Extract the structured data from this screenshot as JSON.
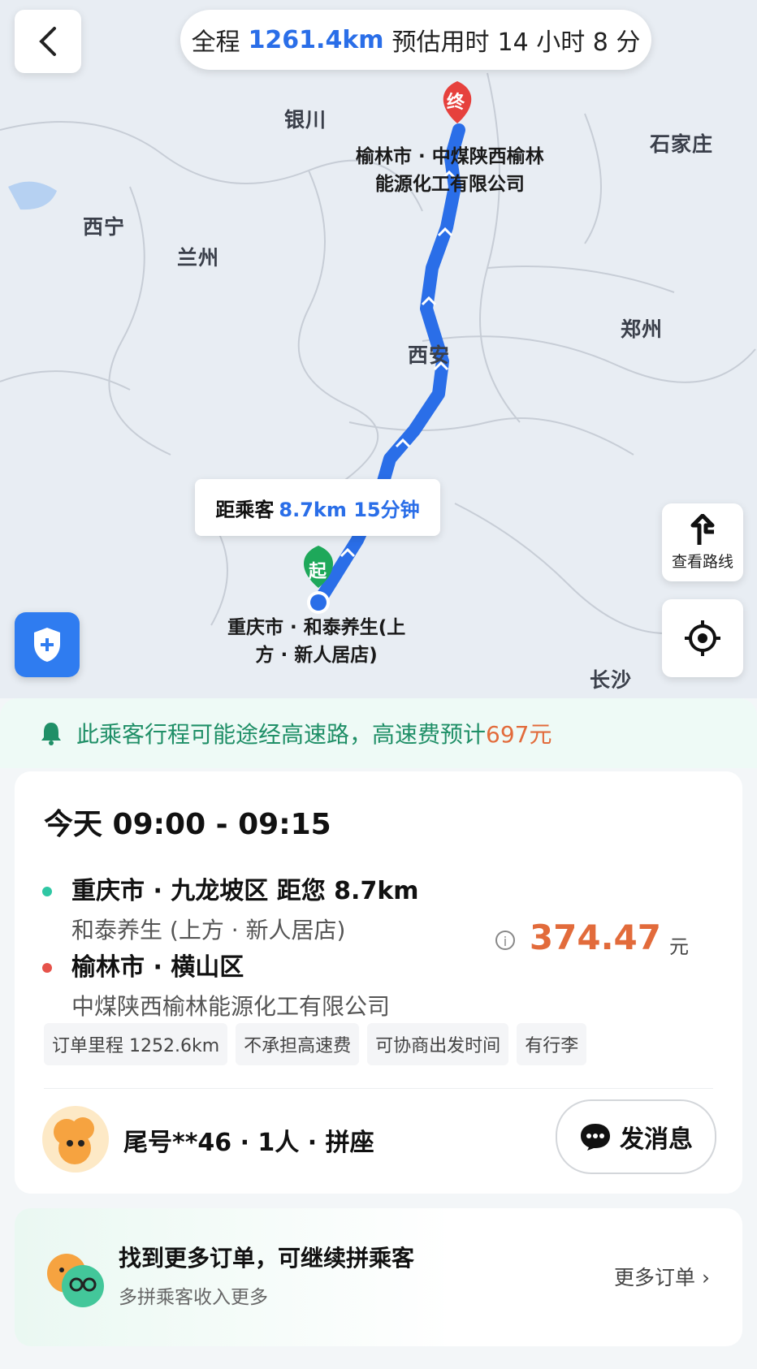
{
  "header": {
    "summary_prefix": "全程",
    "total_distance": "1261.4km",
    "estimate_label": "预估用时",
    "estimate_time": "14 小时 8 分"
  },
  "map": {
    "cities": [
      "银川",
      "石家庄",
      "西宁",
      "兰州",
      "郑州",
      "西安",
      "长沙"
    ],
    "end_marker": "终",
    "end_label_line1": "榆林市 · 中煤陕西榆林",
    "end_label_line2": "能源化工有限公司",
    "start_marker": "起",
    "start_label_line1": "重庆市 · 和泰养生(上",
    "start_label_line2": "方 · 新人居店)",
    "eta_prefix": "距乘客",
    "eta_value": "8.7km 15分钟",
    "route_button_label": "查看路线",
    "route_color": "#2a6ee8"
  },
  "notice": {
    "text": "此乘客行程可能途经高速路，高速费预计",
    "fee": "697元"
  },
  "order": {
    "time_range": "今天 09:00 - 09:15",
    "pickup_main": "重庆市 · 九龙坡区  距您 8.7km",
    "pickup_sub": "和泰养生 (上方 · 新人居店)",
    "dropoff_main": "榆林市 · 横山区",
    "dropoff_sub": "中煤陕西榆林能源化工有限公司",
    "price": "374.47",
    "price_unit": "元",
    "tags": [
      "订单里程 1252.6km",
      "不承担高速费",
      "可协商出发时间",
      "有行李"
    ],
    "passenger": "尾号**46 · 1人 · 拼座",
    "message_button": "发消息"
  },
  "more_orders": {
    "title": "找到更多订单，可继续拼乘客",
    "subtitle": "多拼乘客收入更多",
    "link": "更多订单"
  },
  "colors": {
    "accent_blue": "#2a6ee8",
    "accent_orange": "#e26b3b",
    "accent_green": "#1f8f67",
    "pickup_dot": "#2fc7a4",
    "dropoff_dot": "#e6524a"
  }
}
